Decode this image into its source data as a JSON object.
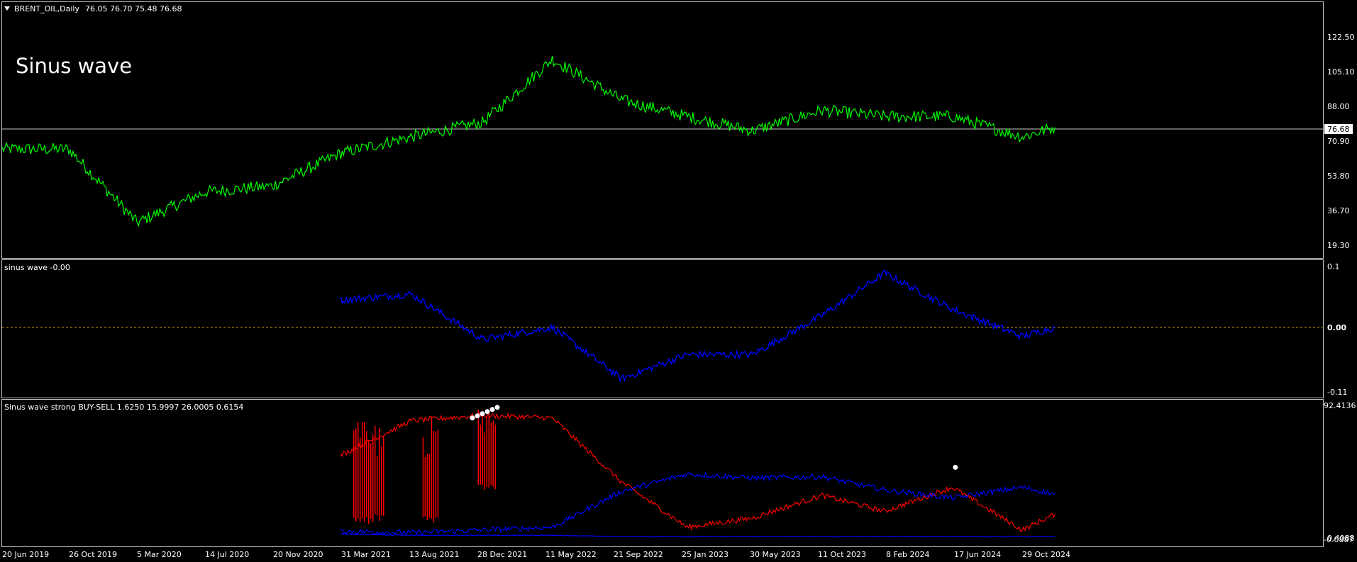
{
  "colors": {
    "background": "#000000",
    "frame": "#c8c8c8",
    "text": "#ffffff",
    "price_line": "#00ff00",
    "sinus_line": "#0000ff",
    "zero_line": "#c8a000",
    "buy_sell_red": "#ff0000",
    "buy_sell_blue": "#0000ff",
    "signal_marker": "#ffffff",
    "current_price_label_bg": "#ffffff",
    "current_price_label_text": "#000000"
  },
  "chart_data": [
    {
      "type": "line",
      "symbol_label": "BRENT_OIL,Daily",
      "ohlc_label": "76.05 76.70 75.48 76.68",
      "annotation": "Sinus wave",
      "x": [
        "2019-06-20",
        "2019-10-26",
        "2020-03-05",
        "2020-07-14",
        "2020-11-20",
        "2021-03-31",
        "2021-08-13",
        "2021-12-28",
        "2022-05-11",
        "2022-09-21",
        "2023-01-25",
        "2023-05-30",
        "2023-10-11",
        "2024-02-08",
        "2024-06-17",
        "2024-10-29",
        "2024-12-31"
      ],
      "series": [
        {
          "values": [
            66,
            66,
            30,
            45,
            48,
            64,
            72,
            79,
            110,
            90,
            82,
            75,
            85,
            82,
            82,
            72,
            76.68
          ]
        }
      ],
      "ylim": [
        13.0,
        138.0
      ],
      "y_ticks": [
        "122.50",
        "105.10",
        "88.00",
        "70.90",
        "53.80",
        "36.70",
        "19.30"
      ],
      "current_price": "76.68"
    },
    {
      "type": "line",
      "label": "sinus wave -0.00",
      "x": [
        "2021-03-31",
        "2021-08-13",
        "2021-12-28",
        "2022-05-11",
        "2022-09-21",
        "2023-01-25",
        "2023-05-30",
        "2023-10-11",
        "2024-02-08",
        "2024-06-17",
        "2024-10-29",
        "2024-12-31"
      ],
      "series": [
        {
          "values": [
            0.045,
            0.055,
            -0.02,
            0.0,
            -0.085,
            -0.045,
            -0.045,
            0.02,
            0.09,
            0.03,
            -0.015,
            0.0
          ]
        }
      ],
      "zero_level": 0.0,
      "ylim": [
        -0.115,
        0.11
      ],
      "y_ticks": [
        "0.1",
        "0.00",
        "-0.11"
      ]
    },
    {
      "type": "line",
      "label": "Sinus wave strong BUY-SELL 1.6250 15.9997 26.0005 0.6154",
      "x": [
        "2021-03-31",
        "2021-08-13",
        "2021-12-28",
        "2022-05-11",
        "2022-09-21",
        "2023-01-25",
        "2023-05-30",
        "2023-10-11",
        "2024-02-08",
        "2024-06-17",
        "2024-10-29",
        "2024-12-31"
      ],
      "series": [
        {
          "values": [
            62,
            88,
            92,
            90,
            42,
            8,
            15,
            32,
            20,
            38,
            6,
            18
          ]
        },
        {
          "values": [
            5,
            4,
            6,
            8,
            35,
            48,
            45,
            46,
            36,
            30,
            38,
            33
          ]
        },
        {
          "values": [
            3,
            2,
            2,
            2,
            1,
            1,
            1,
            1,
            1,
            1,
            1,
            1
          ]
        }
      ],
      "spikes": [
        {
          "from": "2021-04-25",
          "to": "2021-06-25",
          "low": 10,
          "high": 88
        },
        {
          "from": "2021-09-05",
          "to": "2021-10-05",
          "low": 10,
          "high": 92
        },
        {
          "from": "2021-12-20",
          "to": "2022-01-25",
          "low": 35,
          "high": 98
        }
      ],
      "signals": [
        "2022-01-05",
        "2024-07-20"
      ],
      "ylim": [
        -1,
        100
      ],
      "y_ticks": [
        "92.4136",
        "0.4088",
        "-0.0887"
      ]
    }
  ],
  "x_axis_ticks": [
    "20 Jun 2019",
    "26 Oct 2019",
    "5 Mar 2020",
    "14 Jul 2020",
    "20 Nov 2020",
    "31 Mar 2021",
    "13 Aug 2021",
    "28 Dec 2021",
    "11 May 2022",
    "21 Sep 2022",
    "25 Jan 2023",
    "30 May 2023",
    "11 Oct 2023",
    "8 Feb 2024",
    "17 Jun 2024",
    "29 Oct 2024"
  ]
}
